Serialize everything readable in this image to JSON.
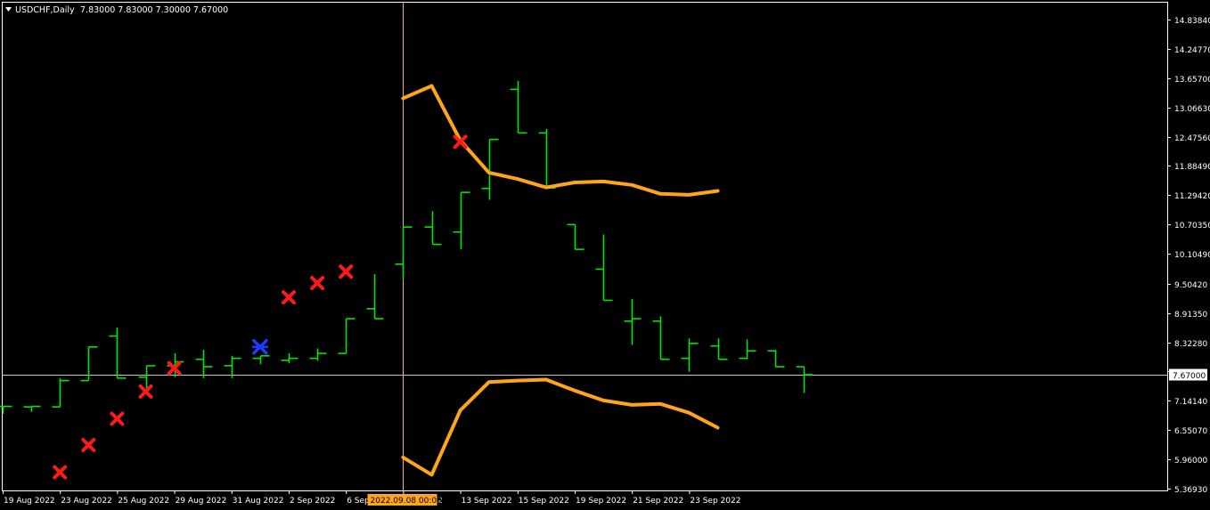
{
  "header": {
    "symbol": "USDCHF,Daily",
    "ohlc": "7.83000 7.83000 7.30000 7.67000"
  },
  "colors": {
    "background": "#000000",
    "frame": "#ffffff",
    "bars": "#00e600",
    "bands": "#ffa51a",
    "signal_sell": "#ff1a1a",
    "signal_buy": "#1a3cff",
    "crosshair_v": "#f0b090",
    "crosshair_h": "#c8c8c8",
    "price_tag_bg": "#ffffff",
    "date_tag_bg": "#ffa51a"
  },
  "price_tag": "7.67000",
  "date_tag": "2022.09.08 00:00",
  "chart_data": {
    "type": "ohlc",
    "symbol": "USDCHF",
    "timeframe": "Daily",
    "y_ticks": [
      "14.83840",
      "14.24770",
      "13.65700",
      "13.06630",
      "12.47560",
      "11.88490",
      "11.29420",
      "10.70350",
      "10.10490",
      "9.50420",
      "8.91350",
      "8.32280",
      "7.73210",
      "7.14140",
      "6.55070",
      "5.96000",
      "5.36930"
    ],
    "ylim": [
      5.3,
      15.05
    ],
    "x_labels": [
      "19 Aug 2022",
      "23 Aug 2022",
      "25 Aug 2022",
      "29 Aug 2022",
      "31 Aug 2022",
      "2 Sep 2022",
      "6 Sep 2022",
      "9 Sep 2022",
      "13 Sep 2022",
      "15 Sep 2022",
      "19 Sep 2022",
      "21 Sep 2022",
      "23 Sep 2022"
    ],
    "x_label_visible_chars": [
      null,
      null,
      null,
      null,
      null,
      null,
      "6 Sep",
      ".2",
      null,
      null,
      null,
      null,
      null
    ],
    "bars": [
      {
        "date": "2022-08-19",
        "o": 7.03,
        "h": 7.03,
        "l": 6.88,
        "c": 7.03
      },
      {
        "date": "2022-08-22",
        "o": 7.02,
        "h": 7.02,
        "l": 6.92,
        "c": 7.03
      },
      {
        "date": "2022-08-23",
        "o": 7.02,
        "h": 7.6,
        "l": 7.02,
        "c": 7.55
      },
      {
        "date": "2022-08-24",
        "o": 7.55,
        "h": 8.23,
        "l": 7.55,
        "c": 8.23
      },
      {
        "date": "2022-08-25",
        "o": 8.45,
        "h": 8.62,
        "l": 7.6,
        "c": 7.6
      },
      {
        "date": "2022-08-26",
        "o": 7.62,
        "h": 7.85,
        "l": 7.4,
        "c": 7.85
      },
      {
        "date": "2022-08-29",
        "o": 7.85,
        "h": 8.1,
        "l": 7.62,
        "c": 7.93
      },
      {
        "date": "2022-08-30",
        "o": 7.98,
        "h": 8.17,
        "l": 7.6,
        "c": 7.83
      },
      {
        "date": "2022-08-31",
        "o": 7.85,
        "h": 8.05,
        "l": 7.6,
        "c": 8.0
      },
      {
        "date": "2022-09-01",
        "o": 8.0,
        "h": 8.05,
        "l": 7.88,
        "c": 8.05
      },
      {
        "date": "2022-09-02",
        "o": 7.96,
        "h": 8.1,
        "l": 7.9,
        "c": 8.0
      },
      {
        "date": "2022-09-05",
        "o": 8.0,
        "h": 8.2,
        "l": 7.95,
        "c": 8.1
      },
      {
        "date": "2022-09-06",
        "o": 8.1,
        "h": 8.8,
        "l": 8.1,
        "c": 8.8
      },
      {
        "date": "2022-09-07",
        "o": 9.0,
        "h": 9.7,
        "l": 8.8,
        "c": 8.8
      },
      {
        "date": "2022-09-08",
        "o": 9.9,
        "h": 10.65,
        "l": 9.6,
        "c": 10.65
      },
      {
        "date": "2022-09-09",
        "o": 10.65,
        "h": 10.97,
        "l": 10.3,
        "c": 10.3
      },
      {
        "date": "2022-09-12",
        "o": 10.55,
        "h": 11.35,
        "l": 10.2,
        "c": 11.35
      },
      {
        "date": "2022-09-13",
        "o": 11.43,
        "h": 12.42,
        "l": 11.2,
        "c": 12.42
      },
      {
        "date": "2022-09-14",
        "o": 13.43,
        "h": 13.6,
        "l": 12.55,
        "c": 12.55
      },
      {
        "date": "2022-09-15",
        "o": 12.55,
        "h": 12.63,
        "l": 11.44,
        "c": 11.44
      },
      {
        "date": "2022-09-16",
        "o": 10.7,
        "h": 10.7,
        "l": 10.2,
        "c": 10.2
      },
      {
        "date": "2022-09-19",
        "o": 9.8,
        "h": 10.5,
        "l": 9.17,
        "c": 9.17
      },
      {
        "date": "2022-09-20",
        "o": 8.75,
        "h": 9.2,
        "l": 8.27,
        "c": 8.8
      },
      {
        "date": "2022-09-21",
        "o": 8.75,
        "h": 8.85,
        "l": 7.98,
        "c": 7.98
      },
      {
        "date": "2022-09-22",
        "o": 8.0,
        "h": 8.4,
        "l": 7.73,
        "c": 8.3
      },
      {
        "date": "2022-09-23",
        "o": 8.25,
        "h": 8.4,
        "l": 7.98,
        "c": 7.98
      },
      {
        "date": "2022-09-26",
        "o": 8.0,
        "h": 8.38,
        "l": 7.98,
        "c": 8.15
      },
      {
        "date": "2022-09-27",
        "o": 8.15,
        "h": 8.17,
        "l": 7.83,
        "c": 7.83
      },
      {
        "date": "2022-09-28",
        "o": 7.83,
        "h": 7.83,
        "l": 7.3,
        "c": 7.67
      }
    ],
    "upper_band": [
      {
        "bar": 14,
        "y": 13.25
      },
      {
        "bar": 15,
        "y": 13.5
      },
      {
        "bar": 16,
        "y": 12.4
      },
      {
        "bar": 17,
        "y": 11.75
      },
      {
        "bar": 18,
        "y": 11.62
      },
      {
        "bar": 19,
        "y": 11.45
      },
      {
        "bar": 20,
        "y": 11.55
      },
      {
        "bar": 21,
        "y": 11.57
      },
      {
        "bar": 22,
        "y": 11.5
      },
      {
        "bar": 23,
        "y": 11.32
      },
      {
        "bar": 24,
        "y": 11.3
      },
      {
        "bar": 25,
        "y": 11.38
      }
    ],
    "lower_band": [
      {
        "bar": 14,
        "y": 6.0
      },
      {
        "bar": 15,
        "y": 5.65
      },
      {
        "bar": 16,
        "y": 6.95
      },
      {
        "bar": 17,
        "y": 7.52
      },
      {
        "bar": 18,
        "y": 7.55
      },
      {
        "bar": 19,
        "y": 7.57
      },
      {
        "bar": 20,
        "y": 7.35
      },
      {
        "bar": 21,
        "y": 7.15
      },
      {
        "bar": 22,
        "y": 7.06
      },
      {
        "bar": 23,
        "y": 7.08
      },
      {
        "bar": 24,
        "y": 6.9
      },
      {
        "bar": 25,
        "y": 6.6
      }
    ],
    "signals": [
      {
        "bar": 2,
        "y": 5.7,
        "kind": "sell"
      },
      {
        "bar": 3,
        "y": 6.25,
        "kind": "sell"
      },
      {
        "bar": 4,
        "y": 6.78,
        "kind": "sell"
      },
      {
        "bar": 5,
        "y": 7.33,
        "kind": "sell"
      },
      {
        "bar": 6,
        "y": 7.8,
        "kind": "sell"
      },
      {
        "bar": 9,
        "y": 8.23,
        "kind": "buy"
      },
      {
        "bar": 10,
        "y": 9.23,
        "kind": "sell"
      },
      {
        "bar": 11,
        "y": 9.52,
        "kind": "sell"
      },
      {
        "bar": 12,
        "y": 9.75,
        "kind": "sell"
      },
      {
        "bar": 16,
        "y": 12.37,
        "kind": "sell"
      }
    ],
    "crosshair": {
      "price": 7.67,
      "date": "2022-09-08"
    },
    "grid": false
  }
}
